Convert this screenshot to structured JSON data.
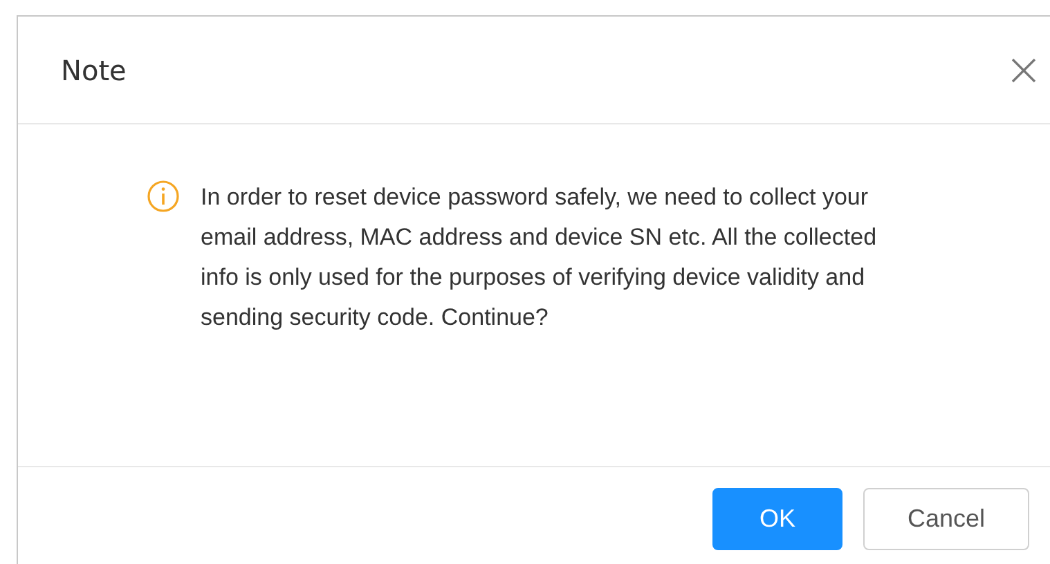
{
  "dialog": {
    "title": "Note",
    "message": "In order to reset device password safely, we need to collect your email address, MAC address and device SN etc. All the collected info is only used for the purposes of verifying device validity and sending security code. Continue?",
    "buttons": [
      {
        "label": "OK",
        "kind": "primary"
      },
      {
        "label": "Cancel",
        "kind": "default"
      }
    ]
  }
}
